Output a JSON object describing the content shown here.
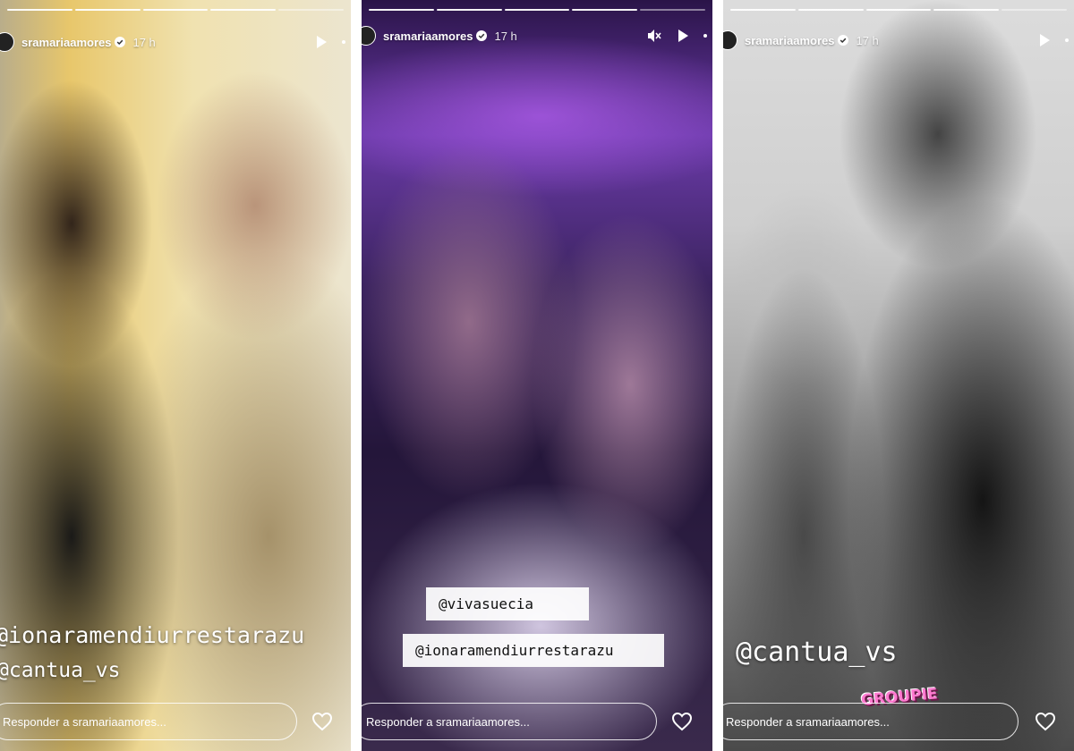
{
  "stories": [
    {
      "username": "sramariaamores",
      "time": "17 h",
      "progress": {
        "segments": 5,
        "completed": 4
      },
      "mentions": [
        "@ionaramendiurrestarazu",
        "@cantua_vs"
      ],
      "reply_placeholder": "Responder a sramariaamores..."
    },
    {
      "username": "sramariaamores",
      "time": "17 h",
      "progress": {
        "segments": 5,
        "completed": 4
      },
      "mentions": [
        "@vivasuecia",
        "@ionaramendiurrestarazu"
      ],
      "reply_placeholder": "Responder a sramariaamores..."
    },
    {
      "username": "sramariaamores",
      "time": "17 h",
      "progress": {
        "segments": 5,
        "completed": 4
      },
      "mentions": [
        "@cantua_vs"
      ],
      "sticker": "GROUPIE",
      "reply_placeholder": "Responder a sramariaamores..."
    }
  ],
  "colors": {
    "verified": "#ffffff",
    "ui_text": "#ffffff",
    "sticker": "#ff7ad0"
  }
}
